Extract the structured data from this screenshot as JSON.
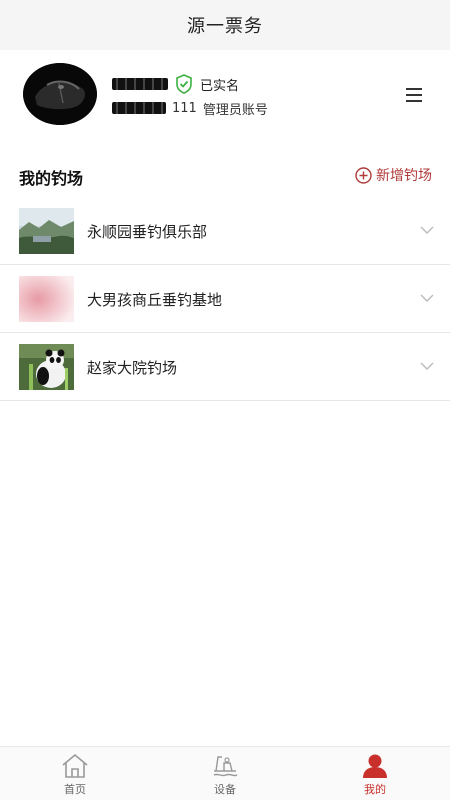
{
  "title_bar": {
    "title": "源一票务"
  },
  "profile": {
    "verified_label": "已实名",
    "account_suffix": "111",
    "account_type": "管理员账号"
  },
  "section": {
    "title": "我的钓场",
    "add_label": "新增钓场"
  },
  "fishing_spots": [
    {
      "name": "永顺园垂钓俱乐部"
    },
    {
      "name": "大男孩商丘垂钓基地"
    },
    {
      "name": "赵家大院钓场"
    }
  ],
  "tabs": [
    {
      "label": "首页",
      "icon": "home-icon"
    },
    {
      "label": "设备",
      "icon": "device-icon"
    },
    {
      "label": "我的",
      "icon": "profile-icon",
      "active": true
    }
  ],
  "colors": {
    "accent": "#c9302c",
    "verified_green": "#3cb043",
    "title_bar_bg": "#f5f5f5"
  }
}
